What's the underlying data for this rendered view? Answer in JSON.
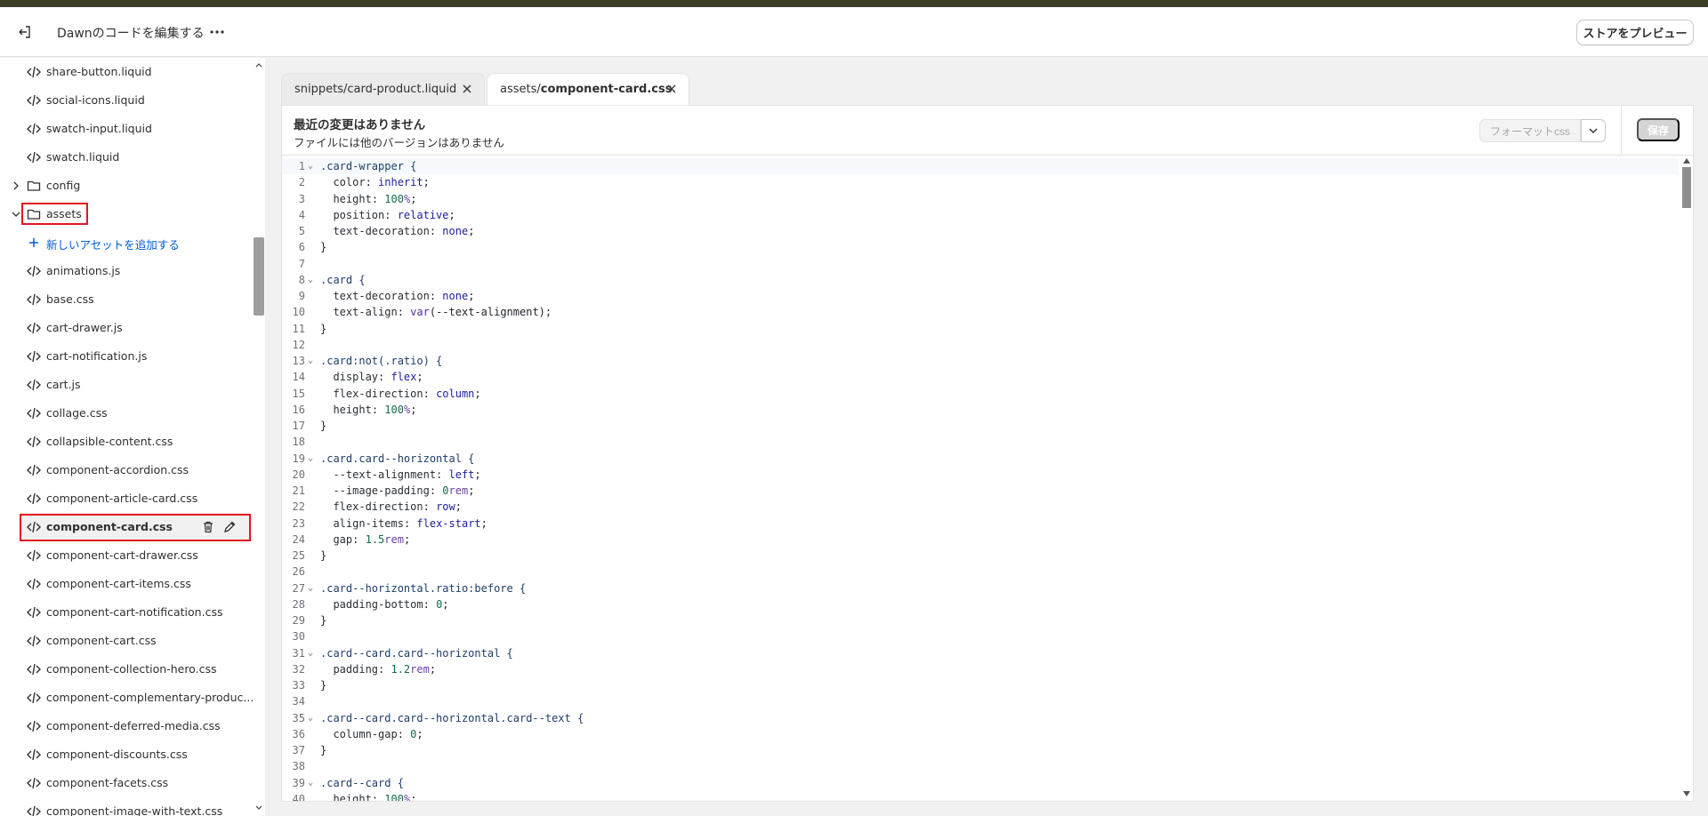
{
  "header": {
    "title": "Dawnのコードを編集する",
    "preview_label": "ストアをプレビュー",
    "back_icon": "exit-icon",
    "more_icon": "more-horizontal-icon"
  },
  "sidebar": {
    "items": [
      {
        "type": "file",
        "label": "share-button.liquid"
      },
      {
        "type": "file",
        "label": "social-icons.liquid"
      },
      {
        "type": "file",
        "label": "swatch-input.liquid"
      },
      {
        "type": "file",
        "label": "swatch.liquid"
      },
      {
        "type": "folder",
        "label": "config",
        "expanded": false
      },
      {
        "type": "folder",
        "label": "assets",
        "expanded": true
      },
      {
        "type": "add",
        "label": "新しいアセットを追加する"
      },
      {
        "type": "file",
        "label": "animations.js"
      },
      {
        "type": "file",
        "label": "base.css"
      },
      {
        "type": "file",
        "label": "cart-drawer.js"
      },
      {
        "type": "file",
        "label": "cart-notification.js"
      },
      {
        "type": "file",
        "label": "cart.js"
      },
      {
        "type": "file",
        "label": "collage.css"
      },
      {
        "type": "file",
        "label": "collapsible-content.css"
      },
      {
        "type": "file",
        "label": "component-accordion.css"
      },
      {
        "type": "file",
        "label": "component-article-card.css"
      },
      {
        "type": "file",
        "label": "component-card.css",
        "active": true
      },
      {
        "type": "file",
        "label": "component-cart-drawer.css"
      },
      {
        "type": "file",
        "label": "component-cart-items.css"
      },
      {
        "type": "file",
        "label": "component-cart-notification.css"
      },
      {
        "type": "file",
        "label": "component-cart.css"
      },
      {
        "type": "file",
        "label": "component-collection-hero.css"
      },
      {
        "type": "file",
        "label": "component-complementary-produc..."
      },
      {
        "type": "file",
        "label": "component-deferred-media.css"
      },
      {
        "type": "file",
        "label": "component-discounts.css"
      },
      {
        "type": "file",
        "label": "component-facets.css"
      },
      {
        "type": "file",
        "label": "component-image-with-text.css"
      }
    ]
  },
  "tabs": [
    {
      "label": "snippets/card-product.liquid",
      "active": false
    },
    {
      "dir": "assets/",
      "file": "component-card.css",
      "active": true
    }
  ],
  "editor": {
    "status_title": "最近の変更はありません",
    "status_sub": "ファイルには他のバージョンはありません",
    "format_label": "フォーマットcss",
    "save_label": "保存",
    "current_line": 1,
    "lines": [
      ".card-wrapper {",
      "  color: inherit;",
      "  height: 100%;",
      "  position: relative;",
      "  text-decoration: none;",
      "}",
      "",
      ".card {",
      "  text-decoration: none;",
      "  text-align: var(--text-alignment);",
      "}",
      "",
      ".card:not(.ratio) {",
      "  display: flex;",
      "  flex-direction: column;",
      "  height: 100%;",
      "}",
      "",
      ".card.card--horizontal {",
      "  --text-alignment: left;",
      "  --image-padding: 0rem;",
      "  flex-direction: row;",
      "  align-items: flex-start;",
      "  gap: 1.5rem;",
      "}",
      "",
      ".card--horizontal.ratio:before {",
      "  padding-bottom: 0;",
      "}",
      "",
      ".card--card.card--horizontal {",
      "  padding: 1.2rem;",
      "}",
      "",
      ".card--card.card--horizontal.card--text {",
      "  column-gap: 0;",
      "}",
      "",
      ".card--card {",
      "  height: 100%;"
    ],
    "fold_lines": [
      1,
      8,
      13,
      19,
      27,
      31,
      35,
      39
    ]
  },
  "colors": {
    "topstrip": "#3b3d27",
    "highlight_box": "#e0161f",
    "link": "#005bd3"
  }
}
